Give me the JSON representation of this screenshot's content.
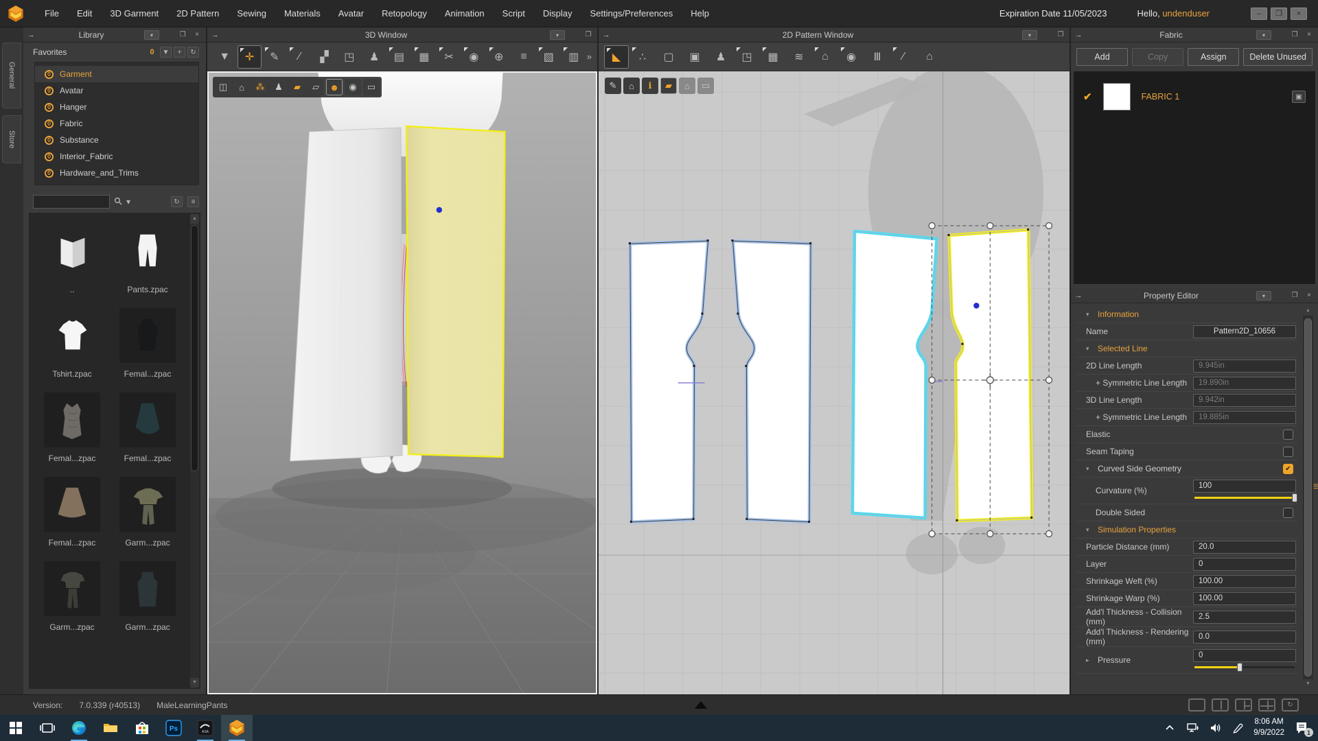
{
  "colors": {
    "accent": "#f0a429",
    "fav_orange": "#e8a33d",
    "sel_yellow": "#f2ee1a",
    "sym_cyan": "#49dff2",
    "outline_blue": "#a9c4ea",
    "dot_blue": "#2230cc",
    "slider_yellow": "#f5d312",
    "underline": "#6cb2e8",
    "fabric_yellow": "#eae7ab",
    "internal_line": "#8581d8"
  },
  "titlebar": {
    "expiration": "Expiration Date 11/05/2023",
    "greeting_prefix": "Hello, ",
    "username": "undenduser",
    "window_buttons": [
      {
        "name": "minimize-button",
        "glyph": "–"
      },
      {
        "name": "restore-button",
        "glyph": "❐"
      },
      {
        "name": "close-button",
        "glyph": "×"
      }
    ]
  },
  "menu": {
    "items": [
      "File",
      "Edit",
      "3D Garment",
      "2D Pattern",
      "Sewing",
      "Materials",
      "Avatar",
      "Retopology",
      "Animation",
      "Script",
      "Display",
      "Settings/Preferences",
      "Help"
    ]
  },
  "side_tabs": [
    {
      "label": "General"
    },
    {
      "label": "Store"
    }
  ],
  "library": {
    "title": "Library",
    "favorites_label": "Favorites",
    "favorites_tools": [
      {
        "name": "favorites-badge-icon",
        "glyph": "0",
        "badge": true
      },
      {
        "name": "import-icon",
        "glyph": "▼"
      },
      {
        "name": "add-favorite-icon",
        "glyph": "+"
      },
      {
        "name": "refresh-favorites-icon",
        "glyph": "↻"
      }
    ],
    "favorites": [
      {
        "label": "Garment",
        "selected": true
      },
      {
        "label": "Avatar",
        "selected": false
      },
      {
        "label": "Hanger",
        "selected": false
      },
      {
        "label": "Fabric",
        "selected": false
      },
      {
        "label": "Substance",
        "selected": false
      },
      {
        "label": "Interior_Fabric",
        "selected": false
      },
      {
        "label": "Hardware_and_Trims",
        "selected": false
      }
    ],
    "search": {
      "value": "",
      "tools": [
        {
          "name": "search-icon"
        },
        {
          "name": "search-filter-dropdown-icon"
        }
      ],
      "right_tools": [
        {
          "name": "refresh-list-icon",
          "glyph": "↻"
        },
        {
          "name": "list-view-icon",
          "glyph": "≡"
        }
      ]
    },
    "items": [
      {
        "label": "..",
        "icon": "folder-up-thumbnail",
        "tile": false
      },
      {
        "label": "Pants.zpac",
        "icon": "pants-thumbnail",
        "tile": false
      },
      {
        "label": "Tshirt.zpac",
        "icon": "tshirt-thumbnail",
        "tile": false
      },
      {
        "label": "Femal...zpac",
        "icon": "dress-dark-thumbnail",
        "tile": true
      },
      {
        "label": "Femal...zpac",
        "icon": "dress-gray-thumbnail",
        "tile": true
      },
      {
        "label": "Femal...zpac",
        "icon": "skirt-teal-thumbnail",
        "tile": true
      },
      {
        "label": "Femal...zpac",
        "icon": "skirt-brown-thumbnail",
        "tile": true
      },
      {
        "label": "Garm...zpac",
        "icon": "outfit-olive-thumbnail",
        "tile": true
      },
      {
        "label": "Garm...zpac",
        "icon": "outfit-gray-thumbnail",
        "tile": true
      },
      {
        "label": "Garm...zpac",
        "icon": "dress-teal-thumbnail",
        "tile": true
      }
    ]
  },
  "window3d": {
    "title": "3D Window",
    "tools": [
      {
        "name": "simulate-icon",
        "glyph": "▼",
        "cursor": false,
        "active": false
      },
      {
        "name": "select-move-icon",
        "glyph": "✛",
        "cursor": true,
        "active": true
      },
      {
        "name": "select-mesh-icon",
        "glyph": "✎",
        "cursor": true,
        "active": false
      },
      {
        "name": "pin-icon",
        "glyph": "∕",
        "cursor": true,
        "active": false
      },
      {
        "name": "fold-arrangement-icon",
        "glyph": "▞",
        "cursor": false,
        "active": false
      },
      {
        "name": "rearrange-pattern-icon",
        "glyph": "◳",
        "cursor": false,
        "active": false
      },
      {
        "name": "avatar-display-icon",
        "glyph": "♟",
        "cursor": false,
        "active": false
      },
      {
        "name": "sewing-machine-icon",
        "glyph": "▤",
        "cursor": true,
        "active": false
      },
      {
        "name": "mesh-grid-icon",
        "glyph": "▦",
        "cursor": true,
        "active": false
      },
      {
        "name": "segment-sew-icon",
        "glyph": "✂",
        "cursor": true,
        "active": false
      },
      {
        "name": "free-sew-icon",
        "glyph": "◉",
        "cursor": true,
        "active": false
      },
      {
        "name": "pin-globe-icon",
        "glyph": "⊕",
        "cursor": true,
        "active": false
      },
      {
        "name": "zipper-icon",
        "glyph": "≡",
        "cursor": false,
        "active": false
      },
      {
        "name": "flatten-icon",
        "glyph": "▧",
        "cursor": true,
        "active": false
      },
      {
        "name": "solidify-icon",
        "glyph": "▥",
        "cursor": true,
        "active": false
      }
    ],
    "overflow_glyph": "»",
    "overlay": [
      {
        "name": "show-3d-garment-icon",
        "glyph": "◫",
        "cls": ""
      },
      {
        "name": "show-3d-style-icon",
        "glyph": "⌂",
        "cls": ""
      },
      {
        "name": "show-particle-icon",
        "glyph": "⁂",
        "cls": "orange"
      },
      {
        "name": "show-avatar-icon",
        "glyph": "♟",
        "cls": ""
      },
      {
        "name": "show-pattern-fill-icon",
        "glyph": "▰",
        "cls": "orange"
      },
      {
        "name": "show-pattern-outline-icon",
        "glyph": "▱",
        "cls": ""
      },
      {
        "name": "show-avatar-head-icon",
        "glyph": "☻",
        "cls": "orange boxed"
      },
      {
        "name": "show-environment-icon",
        "glyph": "◉",
        "cls": ""
      },
      {
        "name": "tape-measure-icon",
        "glyph": "▭",
        "cls": ""
      }
    ]
  },
  "window2d": {
    "title": "2D Pattern Window",
    "tools": [
      {
        "name": "transform-pattern-icon",
        "glyph": "◣",
        "cursor": true,
        "active": true
      },
      {
        "name": "edit-pattern-icon",
        "glyph": "∴",
        "cursor": true,
        "active": false
      },
      {
        "name": "create-pattern-icon",
        "glyph": "▢",
        "cursor": false,
        "active": false
      },
      {
        "name": "create-rectangle-icon",
        "glyph": "▣",
        "cursor": false,
        "active": false
      },
      {
        "name": "avatar-silhouette-icon",
        "glyph": "♟",
        "cursor": false,
        "active": false
      },
      {
        "name": "sewing-machine-2d-icon",
        "glyph": "◳",
        "cursor": true,
        "active": false
      },
      {
        "name": "grid-2d-icon",
        "glyph": "▦",
        "cursor": true,
        "active": false
      },
      {
        "name": "iron-icon",
        "glyph": "≋",
        "cursor": false,
        "active": false
      },
      {
        "name": "shirt-tool-icon",
        "glyph": "⌂",
        "cursor": true,
        "active": false
      },
      {
        "name": "free-sew-2d-icon",
        "glyph": "◉",
        "cursor": true,
        "active": false
      },
      {
        "name": "pleats-icon",
        "glyph": "Ⅲ",
        "cursor": false,
        "active": false
      },
      {
        "name": "internal-line-icon",
        "glyph": "∕",
        "cursor": true,
        "active": false
      },
      {
        "name": "dark-shirt-icon",
        "glyph": "⌂",
        "cursor": false,
        "active": false
      }
    ],
    "overlay": [
      {
        "name": "show-pattern-info-icon",
        "glyph": "✎",
        "cls": ""
      },
      {
        "name": "show-sewing-icon",
        "glyph": "⌂",
        "cls": ""
      },
      {
        "name": "show-annotation-icon",
        "glyph": "ℹ",
        "cls": "orange"
      },
      {
        "name": "show-pattern-fill-2d-icon",
        "glyph": "▰",
        "cls": "orange boxed"
      },
      {
        "name": "lock-pattern-icon",
        "glyph": "⌂",
        "cls": "dim"
      },
      {
        "name": "tape-measure-2d-icon",
        "glyph": "▭",
        "cls": "dim"
      }
    ]
  },
  "fabric_panel": {
    "title": "Fabric",
    "buttons": [
      {
        "label": "Add",
        "enabled": true,
        "wide": false
      },
      {
        "label": "Copy",
        "enabled": false,
        "wide": false
      },
      {
        "label": "Assign",
        "enabled": true,
        "wide": false
      },
      {
        "label": "Delete Unused",
        "enabled": true,
        "wide": true
      }
    ],
    "items": [
      {
        "name": "FABRIC 1",
        "checked": true,
        "swatch": "#ffffff"
      }
    ]
  },
  "property_editor": {
    "title": "Property Editor",
    "rows": [
      {
        "kind": "section",
        "label": "Information"
      },
      {
        "kind": "input",
        "label": "Name",
        "value": "Pattern2D_10656",
        "readonly": false,
        "indent": false,
        "center": true
      },
      {
        "kind": "section",
        "label": "Selected Line"
      },
      {
        "kind": "input",
        "label": "2D Line Length",
        "value": "9.945in",
        "readonly": true,
        "indent": false
      },
      {
        "kind": "input",
        "label": "+ Symmetric Line Length",
        "value": "19.890in",
        "readonly": true,
        "indent": true
      },
      {
        "kind": "input",
        "label": "3D Line Length",
        "value": "9.942in",
        "readonly": true,
        "indent": false
      },
      {
        "kind": "input",
        "label": "+ Symmetric Line Length",
        "value": "19.885in",
        "readonly": true,
        "indent": true
      },
      {
        "kind": "checkbox",
        "label": "Elastic",
        "checked": false,
        "indent": false
      },
      {
        "kind": "checkbox",
        "label": "Seam Taping",
        "checked": false,
        "indent": false
      },
      {
        "kind": "subsection",
        "label": "Curved Side Geometry",
        "checked": true
      },
      {
        "kind": "slider",
        "label": "Curvature (%)",
        "value": "100",
        "percent": 100,
        "indent": true
      },
      {
        "kind": "checkbox",
        "label": "Double Sided",
        "checked": false,
        "indent": true
      },
      {
        "kind": "section",
        "label": "Simulation Properties"
      },
      {
        "kind": "input",
        "label": "Particle Distance (mm)",
        "value": "20.0",
        "readonly": false,
        "indent": false
      },
      {
        "kind": "input",
        "label": "Layer",
        "value": "0",
        "readonly": false,
        "indent": false
      },
      {
        "kind": "input",
        "label": "Shrinkage Weft (%)",
        "value": "100.00",
        "readonly": false,
        "indent": false
      },
      {
        "kind": "input",
        "label": "Shrinkage Warp (%)",
        "value": "100.00",
        "readonly": false,
        "indent": false
      },
      {
        "kind": "input",
        "label": "Add'l Thickness - Collision (mm)",
        "value": "2.5",
        "readonly": false,
        "indent": false
      },
      {
        "kind": "input",
        "label": "Add'l Thickness - Rendering (mm)",
        "value": "0.0",
        "readonly": false,
        "indent": false
      },
      {
        "kind": "slider-collapsed",
        "label": "Pressure",
        "value": "0",
        "percent": 45
      }
    ]
  },
  "status_bar": {
    "version_label": "Version:",
    "version": "7.0.339 (r40513)",
    "project": "MaleLearningPants",
    "layout_presets": [
      "layout-single-icon",
      "layout-two-pane-icon",
      "layout-right-split-icon",
      "layout-quad-icon",
      "layout-reset-icon"
    ]
  },
  "taskbar": {
    "apps": [
      {
        "name": "start-button",
        "running": false,
        "active": false
      },
      {
        "name": "task-view-button",
        "running": false,
        "active": false
      },
      {
        "name": "edge-app",
        "running": true,
        "active": false
      },
      {
        "name": "file-explorer-app",
        "running": false,
        "active": false
      },
      {
        "name": "store-app",
        "running": false,
        "active": false
      },
      {
        "name": "photoshop-app",
        "running": false,
        "active": false
      },
      {
        "name": "clo-asa-app",
        "running": true,
        "active": false
      },
      {
        "name": "clo3d-app",
        "running": true,
        "active": true
      }
    ],
    "tray": [
      {
        "name": "hidden-icons-chevron"
      },
      {
        "name": "network-icon"
      },
      {
        "name": "volume-icon"
      },
      {
        "name": "pen-icon"
      }
    ],
    "clock_time": "8:06 AM",
    "clock_date": "9/9/2022",
    "notification_badge": "1"
  }
}
